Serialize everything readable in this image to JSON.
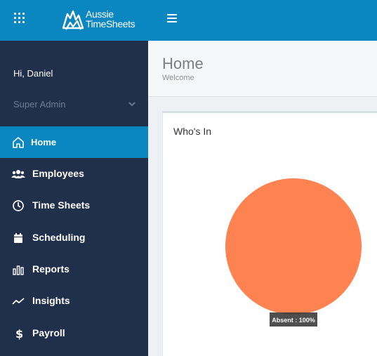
{
  "topbar": {
    "apps_icon": "grid-icon",
    "logo_line1": "Aussie",
    "logo_line2": "TimeSheets",
    "menu_icon": "hamburger-icon",
    "color": "#0a86c0"
  },
  "sidebar": {
    "greeting": "Hi, Daniel",
    "role": "Super Admin",
    "items": [
      {
        "label": "Home",
        "icon": "home-icon"
      },
      {
        "label": "Employees",
        "icon": "users-icon"
      },
      {
        "label": "Time Sheets",
        "icon": "clock-icon"
      },
      {
        "label": "Scheduling",
        "icon": "calendar-icon"
      },
      {
        "label": "Reports",
        "icon": "bar-chart-icon"
      },
      {
        "label": "Insights",
        "icon": "trend-line-icon"
      },
      {
        "label": "Payroll",
        "icon": "dollar-icon"
      }
    ],
    "active": "Home"
  },
  "header": {
    "title": "Home",
    "subtitle": "Welcome"
  },
  "panel": {
    "title": "Who's In"
  },
  "chart_data": {
    "type": "pie",
    "title": "",
    "slices": [
      {
        "label": "Absent",
        "value": 100,
        "color": "#ff8350"
      }
    ],
    "tooltip": "Absent : 100%"
  }
}
